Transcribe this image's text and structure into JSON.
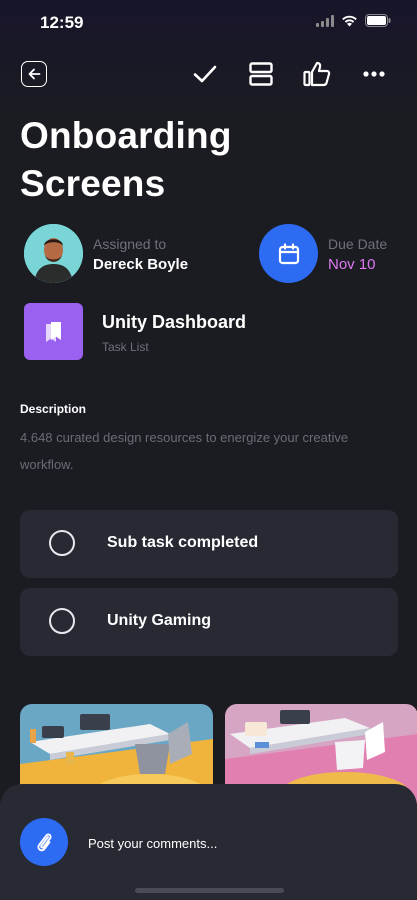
{
  "status_bar": {
    "time": "12:59",
    "icons": [
      "signal-icon",
      "wifi-icon",
      "battery-icon"
    ]
  },
  "toolbar": {
    "icons": [
      "back-arrow-icon",
      "checkmark-icon",
      "layout-icon",
      "thumbs-up-icon",
      "more-icon"
    ]
  },
  "task": {
    "title": "Onboarding\n Screens",
    "assigned_label": "Assigned to",
    "assignee": "Dereck Boyle",
    "due_label": "Due Date",
    "due_date": "Nov 10",
    "project_name": "Unity Dashboard",
    "project_type": "Task List",
    "description_heading": "Description",
    "description": "4.648 curated design resources to energize your creative workflow."
  },
  "subtasks": [
    {
      "label": "Sub task completed",
      "checked": false
    },
    {
      "label": "Unity Gaming",
      "checked": false
    }
  ],
  "gallery": {
    "images": [
      "office-desk-illustration-yellow",
      "office-desk-illustration-pink"
    ]
  },
  "comment": {
    "placeholder": "Post your comments..."
  },
  "colors": {
    "background": "#1b1c22",
    "card": "#272a33",
    "accent_blue": "#2d6bf3",
    "accent_purple": "#9a61f0",
    "due_date_pink": "#e079f2",
    "muted_text": "#6f717d"
  }
}
